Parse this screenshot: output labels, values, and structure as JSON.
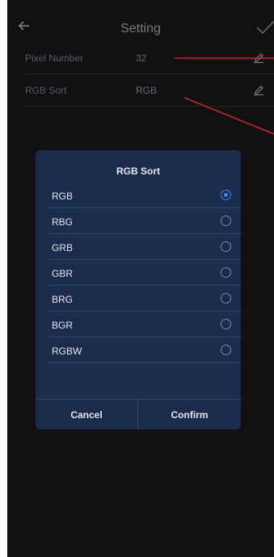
{
  "header": {
    "title": "Setting"
  },
  "settings": [
    {
      "label": "Pixel Number",
      "value": "32"
    },
    {
      "label": "RGB Sort",
      "value": "RGB"
    }
  ],
  "dialog": {
    "title": "RGB Sort",
    "options": [
      {
        "label": "RGB",
        "selected": true
      },
      {
        "label": "RBG",
        "selected": false
      },
      {
        "label": "GRB",
        "selected": false
      },
      {
        "label": "GBR",
        "selected": false
      },
      {
        "label": "BRG",
        "selected": false
      },
      {
        "label": "BGR",
        "selected": false
      },
      {
        "label": "RGBW",
        "selected": false
      }
    ],
    "cancel_label": "Cancel",
    "confirm_label": "Confirm"
  },
  "colors": {
    "background": "#111113",
    "dialog_bg": "#1b2b4c",
    "accent": "#2e8df0",
    "annotation": "#d0222a"
  },
  "icons": {
    "back": "arrow-left-icon",
    "save": "check-icon",
    "edit": "pencil-icon"
  }
}
